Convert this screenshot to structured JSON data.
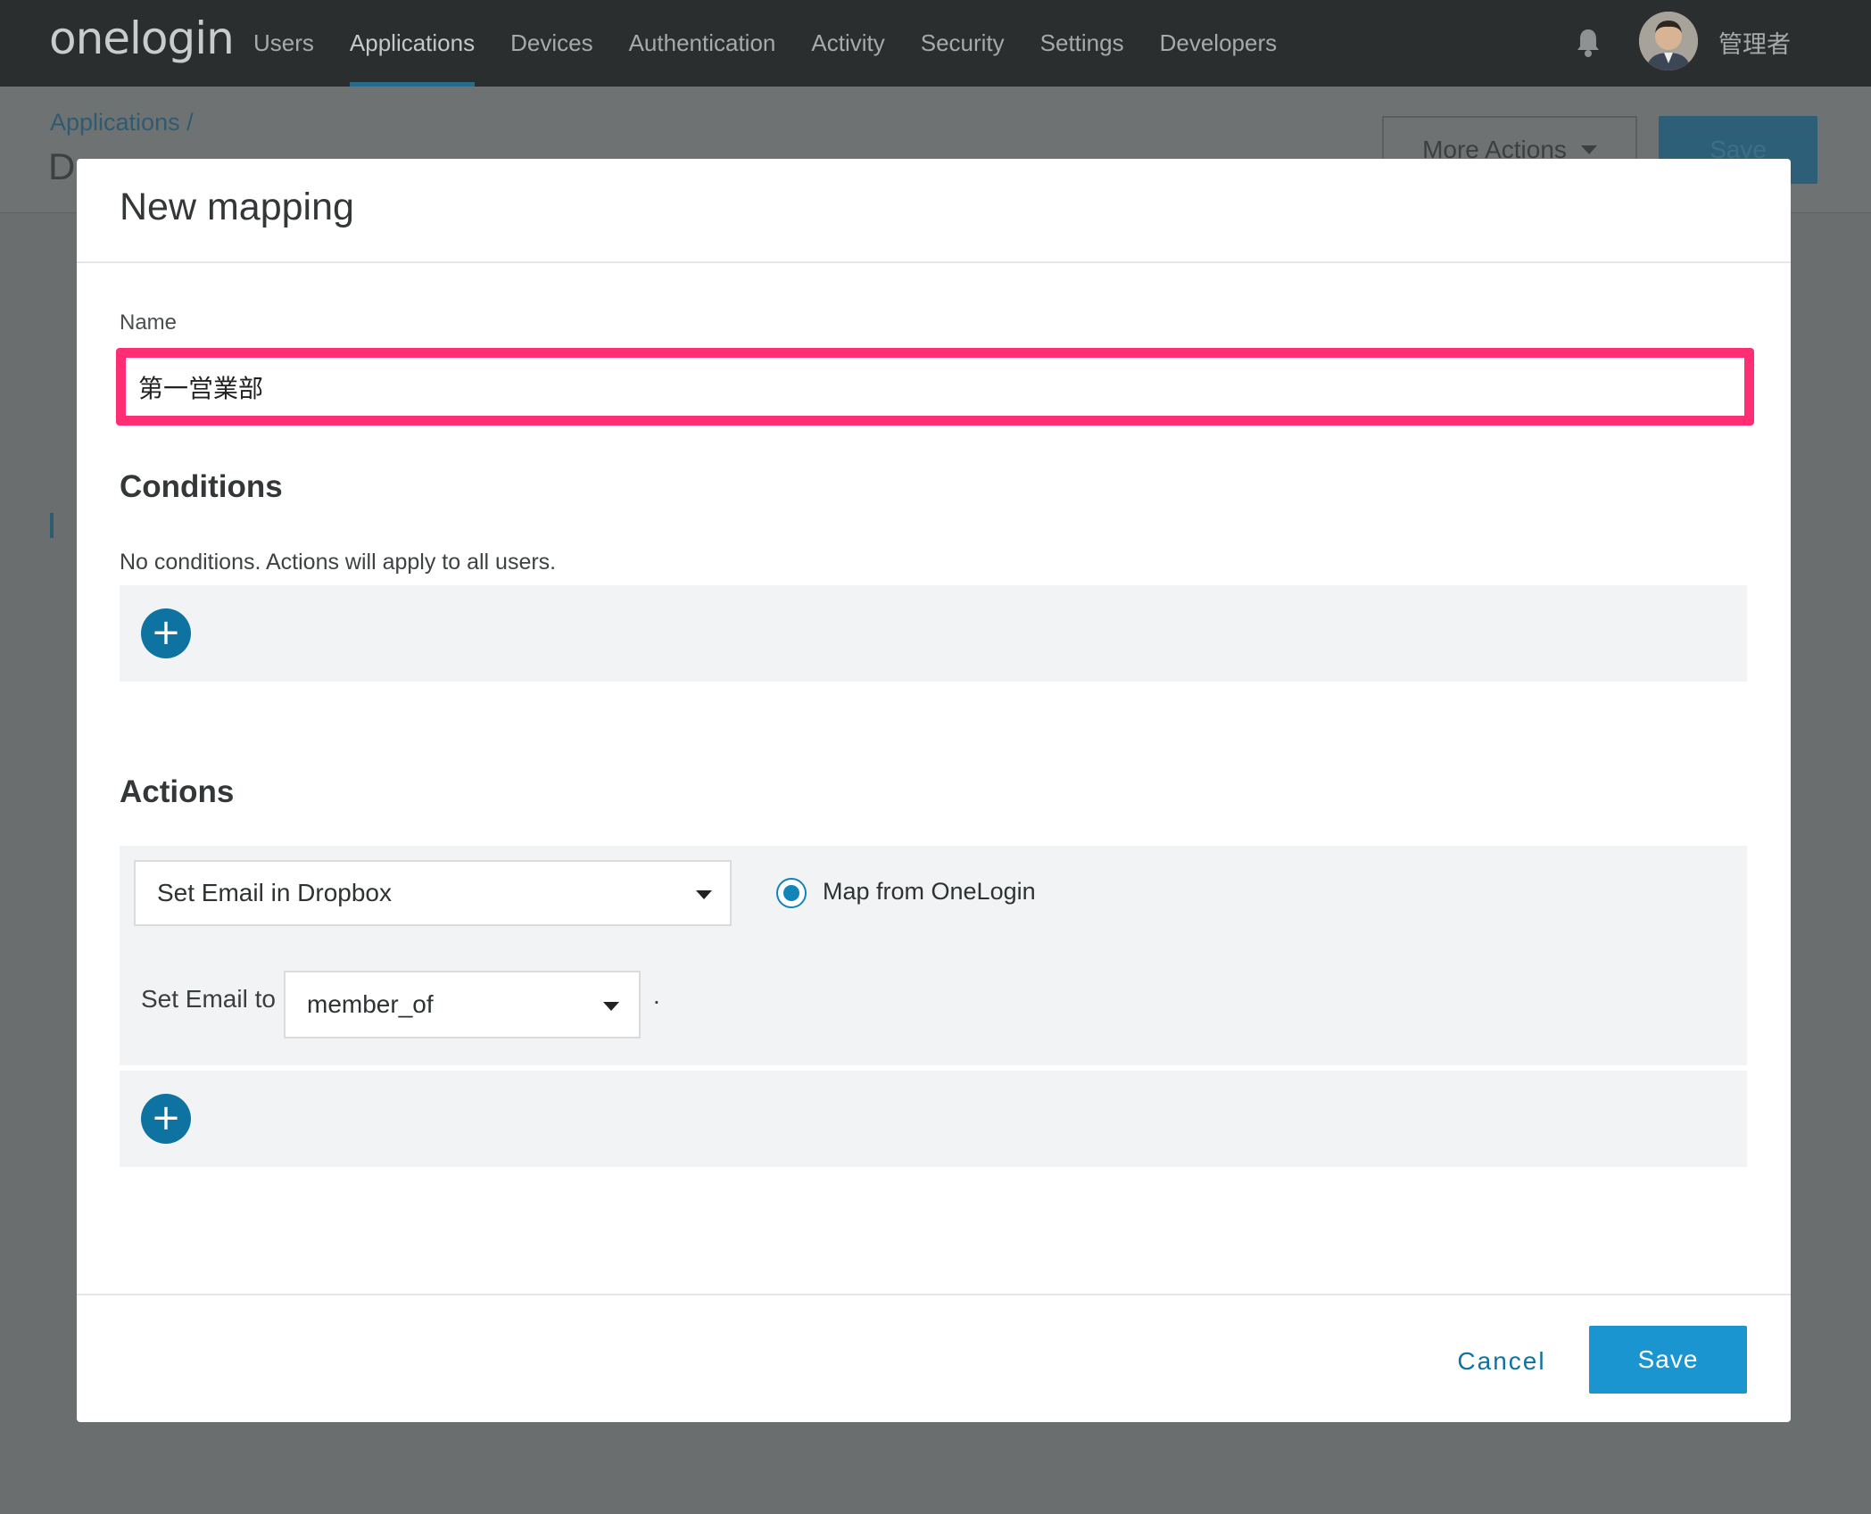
{
  "topbar": {
    "logo": "onelogin",
    "nav": [
      "Users",
      "Applications",
      "Devices",
      "Authentication",
      "Activity",
      "Security",
      "Settings",
      "Developers"
    ],
    "active_nav": "Applications",
    "username": "管理者",
    "bell_icon": "bell-icon",
    "avatar_icon": "avatar"
  },
  "background_page": {
    "breadcrumb": "Applications /",
    "title_partial": "D",
    "more_actions_label": "More Actions",
    "save_label": "Save"
  },
  "modal": {
    "title": "New mapping",
    "name_label": "Name",
    "name_value": "第一営業部",
    "conditions_title": "Conditions",
    "conditions_note": "No conditions. Actions will apply to all users.",
    "actions_title": "Actions",
    "action_select_value": "Set Email in Dropbox",
    "radio_label": "Map from OneLogin",
    "radio_checked": true,
    "set_label": "Set Email to",
    "set_select_value": "member_of",
    "trailing_period": ".",
    "add_icon": "plus-icon",
    "cancel_label": "Cancel",
    "save_label": "Save"
  },
  "colors": {
    "topbar_bg": "#2b2e2f",
    "accent": "#1a95cf",
    "highlight_border": "#ff2d73",
    "panel_bg": "#f2f3f4",
    "plus_button": "#0f73a1"
  }
}
